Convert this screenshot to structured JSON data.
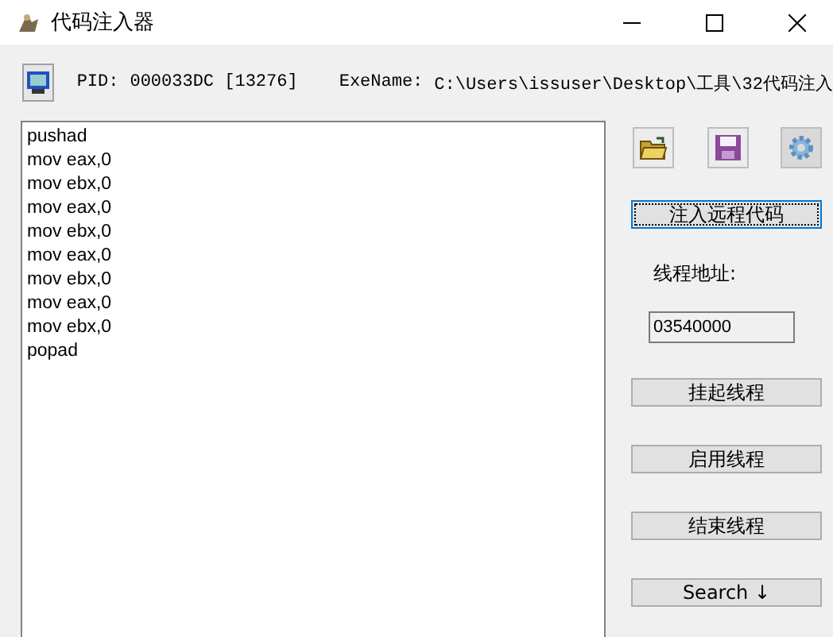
{
  "window": {
    "title": "代码注入器"
  },
  "info_bar": {
    "pid_label": "PID:",
    "pid": "000033DC [13276]",
    "exe_label": "ExeName:",
    "exe_path": "C:\\Users\\issuser\\Desktop\\工具\\32代码注入"
  },
  "code_lines": [
    "pushad",
    "mov eax,0",
    "mov ebx,0",
    "mov eax,0",
    "mov ebx,0",
    "mov eax,0",
    "mov ebx,0",
    "mov eax,0",
    "mov ebx,0",
    "popad"
  ],
  "tool_buttons": [
    {
      "kind": "open",
      "disabled": false
    },
    {
      "kind": "save",
      "disabled": false
    },
    {
      "kind": "settings",
      "disabled": true
    }
  ],
  "inject_button": {
    "label": "注入远程代码",
    "focused": true
  },
  "thread_address": {
    "label": "线程地址:",
    "value": "03540000"
  },
  "thread_buttons": [
    {
      "label": "挂起线程"
    },
    {
      "label": "启用线程"
    },
    {
      "label": "结束线程"
    },
    {
      "label": "Search ↓"
    }
  ]
}
